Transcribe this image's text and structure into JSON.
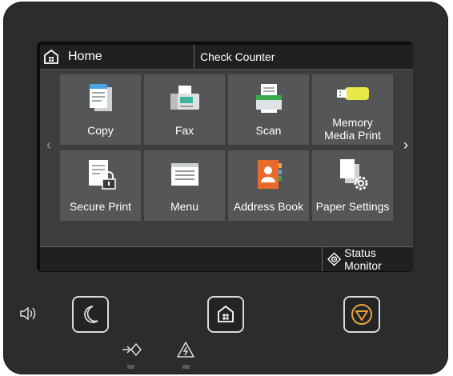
{
  "header": {
    "home_label": "Home",
    "check_counter_label": "Check Counter"
  },
  "tiles": [
    {
      "label": "Copy",
      "icon": "copy-icon"
    },
    {
      "label": "Fax",
      "icon": "fax-icon"
    },
    {
      "label": "Scan",
      "icon": "scan-icon"
    },
    {
      "label_line1": "Memory",
      "label_line2": "Media Print",
      "icon": "memory-media-icon"
    },
    {
      "label": "Secure Print",
      "icon": "secure-print-icon"
    },
    {
      "label": "Menu",
      "icon": "menu-icon"
    },
    {
      "label": "Address Book",
      "icon": "address-book-icon"
    },
    {
      "label": "Paper Settings",
      "icon": "paper-settings-icon"
    }
  ],
  "pager": {
    "current": "1"
  },
  "footer": {
    "status_monitor_label": "Status Monitor"
  },
  "colors": {
    "screen_bg": "#3d3e40",
    "tile_bg": "#555658",
    "bar_bg": "#1f2021",
    "stop_button": "#e8a33a",
    "scan_green": "#3aa84a",
    "memory_yellow": "#e8e84a",
    "address_orange": "#e86a2a"
  }
}
